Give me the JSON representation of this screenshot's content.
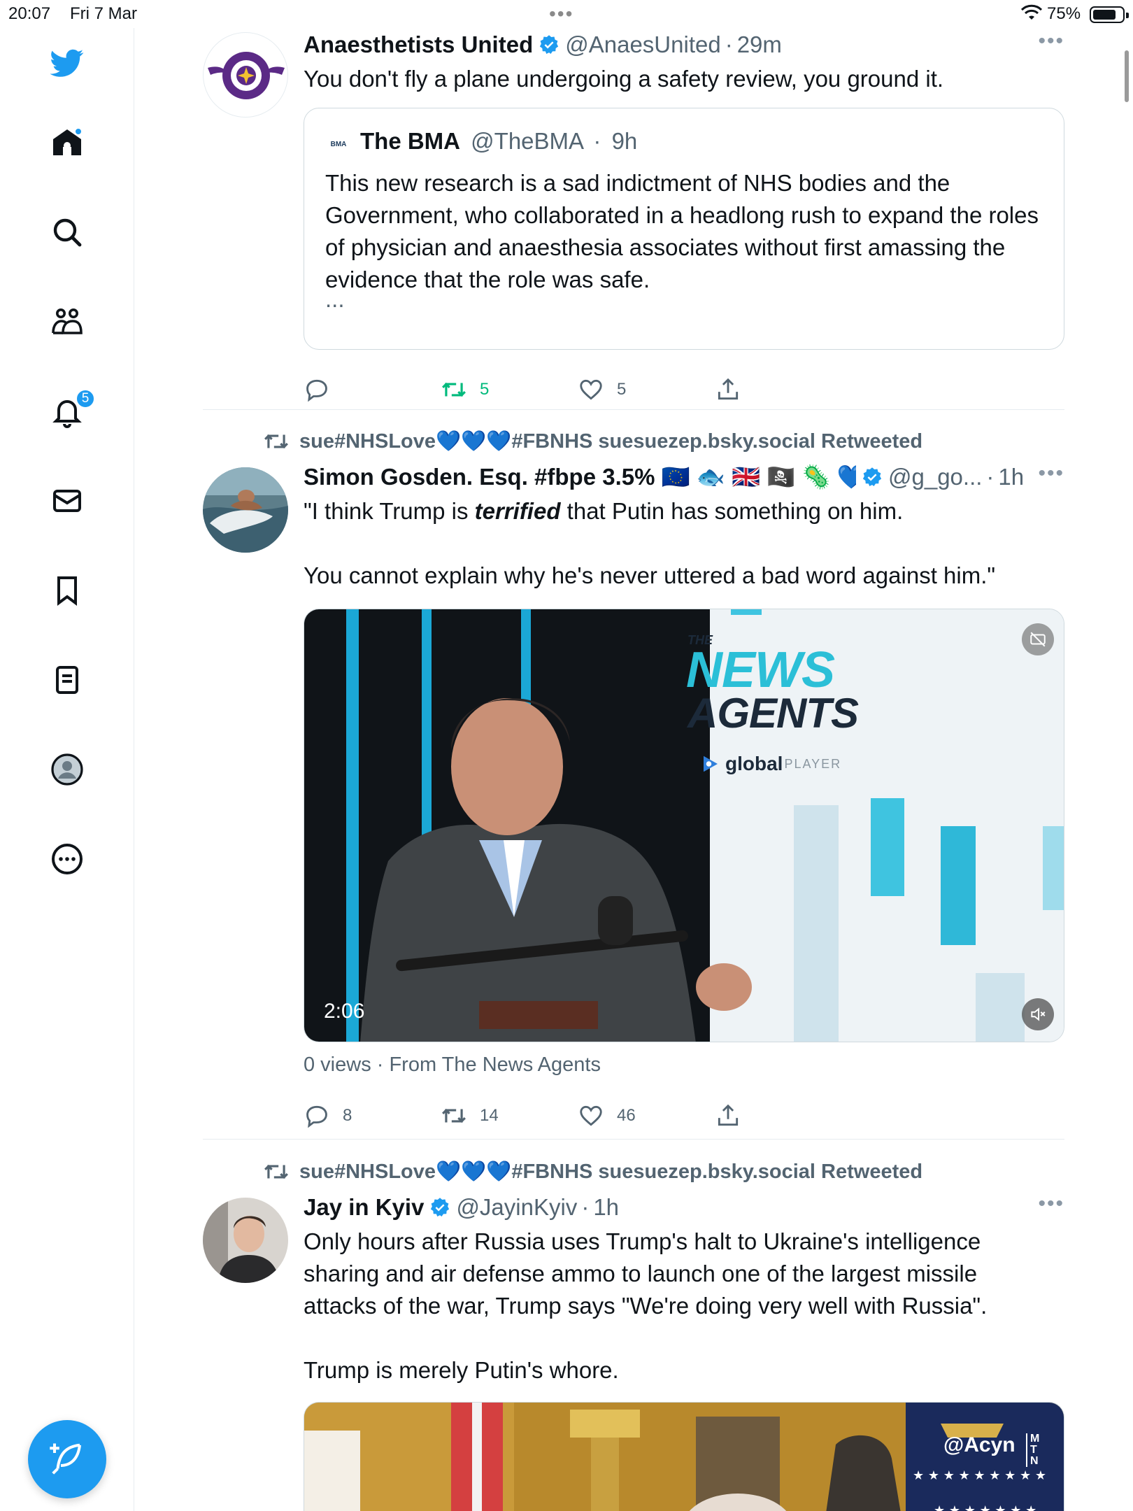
{
  "status_bar": {
    "time": "20:07",
    "date": "Fri 7 Mar",
    "battery": "75%",
    "dots": "•••"
  },
  "sidebar": {
    "notifications_badge": "5"
  },
  "tweets": [
    {
      "name": "Anaesthetists United",
      "handle": "@AnaesUnited",
      "time": "29m",
      "text": "You don't fly a plane undergoing a safety review, you ground it.",
      "quote": {
        "name": "The BMA",
        "handle": "@TheBMA",
        "time": "9h",
        "logo_text": "BMA",
        "text": "This new research is a sad indictment of NHS bodies and the Government, who collaborated in a headlong rush to expand the roles of physician and anaesthesia associates without first amassing the evidence that the role was safe.",
        "ellipsis": "..."
      },
      "retweets": "5",
      "likes": "5"
    },
    {
      "retweeted_by": "sue#NHSLove💙💙💙#FBNHS suesuezep.bsky.social Retweeted",
      "name": "Simon Gosden. Esq. #fbpe 3.5% 🇪🇺 🐟 🇬🇧 🏴‍☠️ 🦠 💙",
      "handle": "@g_go...",
      "time": "1h",
      "text_before": "\"I think Trump is ",
      "text_emphasis": "terrified",
      "text_after": " that Putin has something on him.\n\nYou cannot explain why he's never uttered a bad word against him.\"",
      "video": {
        "duration": "2:06",
        "brand_the": "THE",
        "brand_news": "NEWS",
        "brand_agents": "AGENTS",
        "brand_global": "global",
        "brand_player": "PLAYER"
      },
      "views": "0 views · From The News Agents",
      "replies": "8",
      "retweets": "14",
      "likes": "46"
    },
    {
      "retweeted_by": "sue#NHSLove💙💙💙#FBNHS suesuezep.bsky.social Retweeted",
      "name": "Jay in Kyiv",
      "handle": "@JayinKyiv",
      "time": "1h",
      "text": "Only hours after Russia uses Trump's halt to Ukraine's intelligence sharing and air defense ammo to launch one of the largest missile attacks of the war, Trump says \"We're doing very well with Russia\".\n\nTrump is merely Putin's whore.",
      "media_watermark": "@Acyn",
      "media_logo": "MTN"
    }
  ]
}
